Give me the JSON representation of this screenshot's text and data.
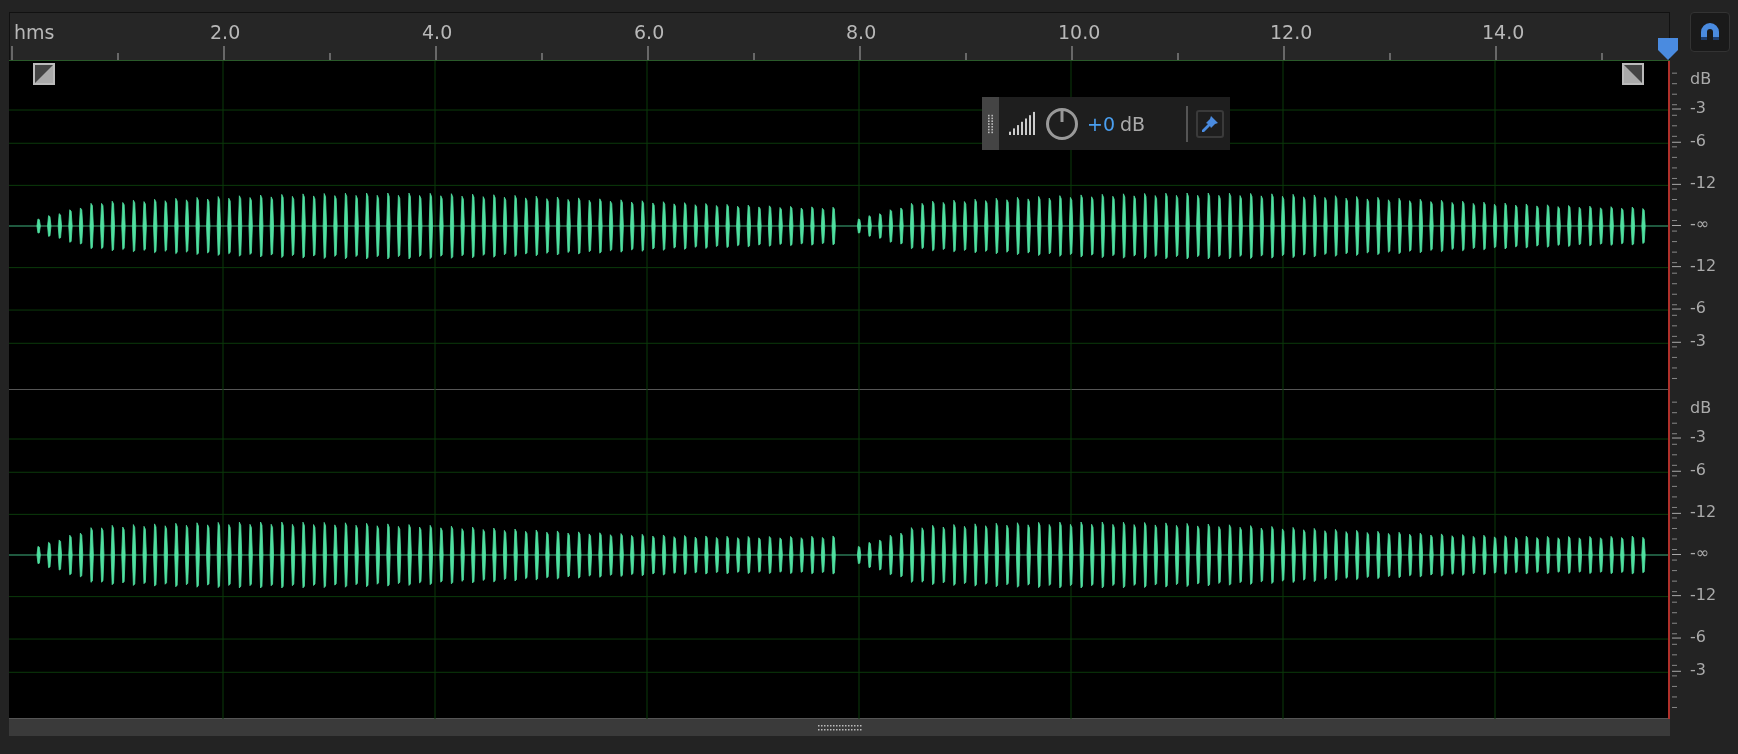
{
  "ruler": {
    "unit": "hms",
    "labels": [
      "2.0",
      "4.0",
      "6.0",
      "8.0",
      "10.0",
      "12.0",
      "14.0"
    ]
  },
  "channels": [
    {
      "scale": [
        "dB",
        "-3",
        "-6",
        "-12",
        "-∞",
        "-12",
        "-6",
        "-3"
      ]
    },
    {
      "scale": [
        "dB",
        "-3",
        "-6",
        "-12",
        "-∞",
        "-12",
        "-6",
        "-3"
      ]
    }
  ],
  "hud": {
    "value": "+0",
    "unit": "dB"
  }
}
